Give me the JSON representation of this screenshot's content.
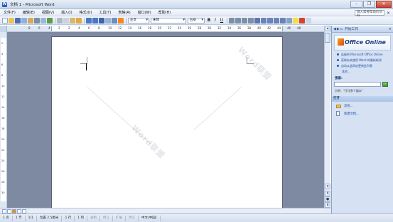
{
  "window": {
    "title": "文档 1 - Microsoft Word",
    "minimize": "–",
    "restore": "❐",
    "close": "✕"
  },
  "menu": {
    "items": [
      "文件(F)",
      "编辑(E)",
      "视图(V)",
      "插入(I)",
      "格式(O)",
      "工具(T)",
      "表格(A)",
      "窗口(W)",
      "帮助(H)"
    ],
    "help_box": "键入需要帮助的问题",
    "close": "×"
  },
  "toolbar": {
    "style_value": "正文",
    "font_value": "宋体",
    "size_value": "五号",
    "bold": "B",
    "italic": "I",
    "underline": "U",
    "colors": {
      "accent_orange": "#f58a1f",
      "accent_blue": "#2b5fb8",
      "accent_red": "#d8402b",
      "accent_green": "#3f9a2c"
    }
  },
  "ruler": {
    "numbers": [
      "8",
      "6",
      "4",
      "2",
      "2",
      "4",
      "6",
      "8",
      "10",
      "12",
      "14",
      "16",
      "18",
      "20",
      "22",
      "24",
      "26",
      "28",
      "30",
      "32",
      "34",
      "36",
      "38",
      "40",
      "42",
      "44",
      "46",
      "48"
    ]
  },
  "vruler": {
    "numbers": [
      "2",
      "4",
      "6",
      "8",
      "10",
      "12",
      "14",
      "16",
      "18",
      "20",
      "22",
      "24",
      "26",
      "28",
      "30"
    ]
  },
  "taskpane": {
    "title": "开始工作",
    "office_online": "Office Online",
    "links": [
      "连接到 Microsoft Office Online",
      "获取有关使用 Word 的最新新闻",
      "自动从此网站更新此列表"
    ],
    "more": "其他...",
    "search_label": "搜索:",
    "example": "示例：\"打印多个副本\"",
    "open_header": "打开",
    "open_items": [
      "其他...",
      "新建文档..."
    ]
  },
  "statusbar": {
    "items": [
      "1 页",
      "1 节",
      "1/1",
      "位置 2.5厘米",
      "1 行",
      "1 列",
      "录制",
      "修订",
      "扩展",
      "改写",
      "中文(中国)"
    ]
  },
  "watermark": {
    "text": "Word联盟"
  }
}
